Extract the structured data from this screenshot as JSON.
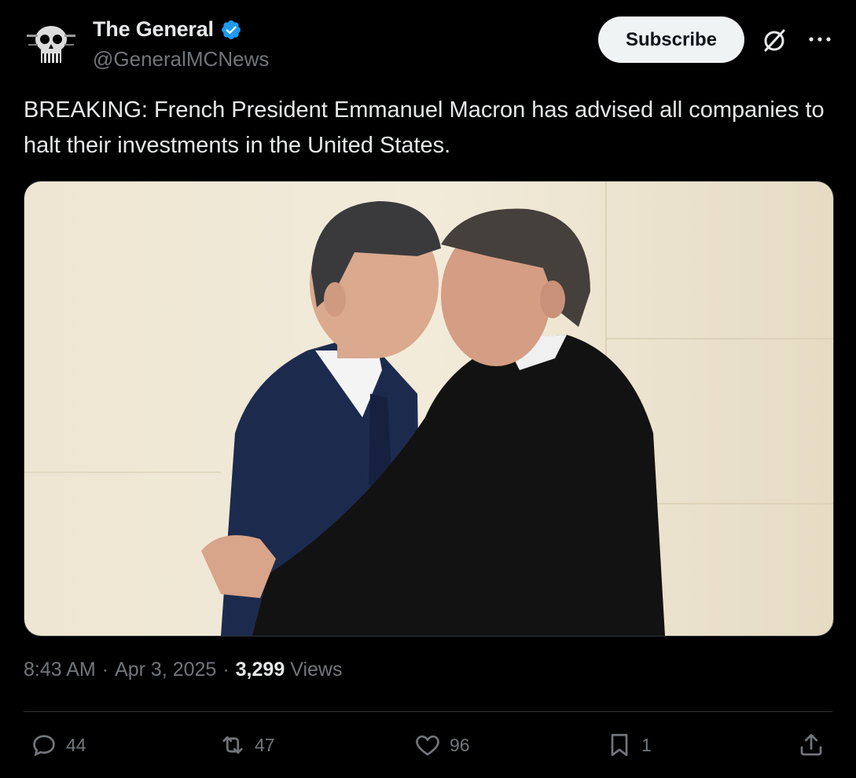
{
  "author": {
    "display_name": "The General",
    "handle": "@GeneralMCNews",
    "verified": true,
    "avatar_icon": "skull-avatar-icon"
  },
  "header": {
    "subscribe_label": "Subscribe",
    "grok_icon": "grok-icon",
    "more_icon": "more-icon"
  },
  "tweet": {
    "text": "BREAKING: French President Emmanuel Macron has advised all companies to halt their investments in the United States."
  },
  "media": {
    "description_icon": "photo"
  },
  "meta": {
    "time": "8:43 AM",
    "date": "Apr 3, 2025",
    "views_count": "3,299",
    "views_label": "Views"
  },
  "actions": {
    "replies": "44",
    "reposts": "47",
    "likes": "96",
    "bookmarks": "1"
  },
  "colors": {
    "background": "#000000",
    "text": "#e7e9ea",
    "secondary": "#71767b",
    "verified": "#1d9bf0",
    "divider": "#2f3336",
    "button_bg": "#eff3f4"
  }
}
